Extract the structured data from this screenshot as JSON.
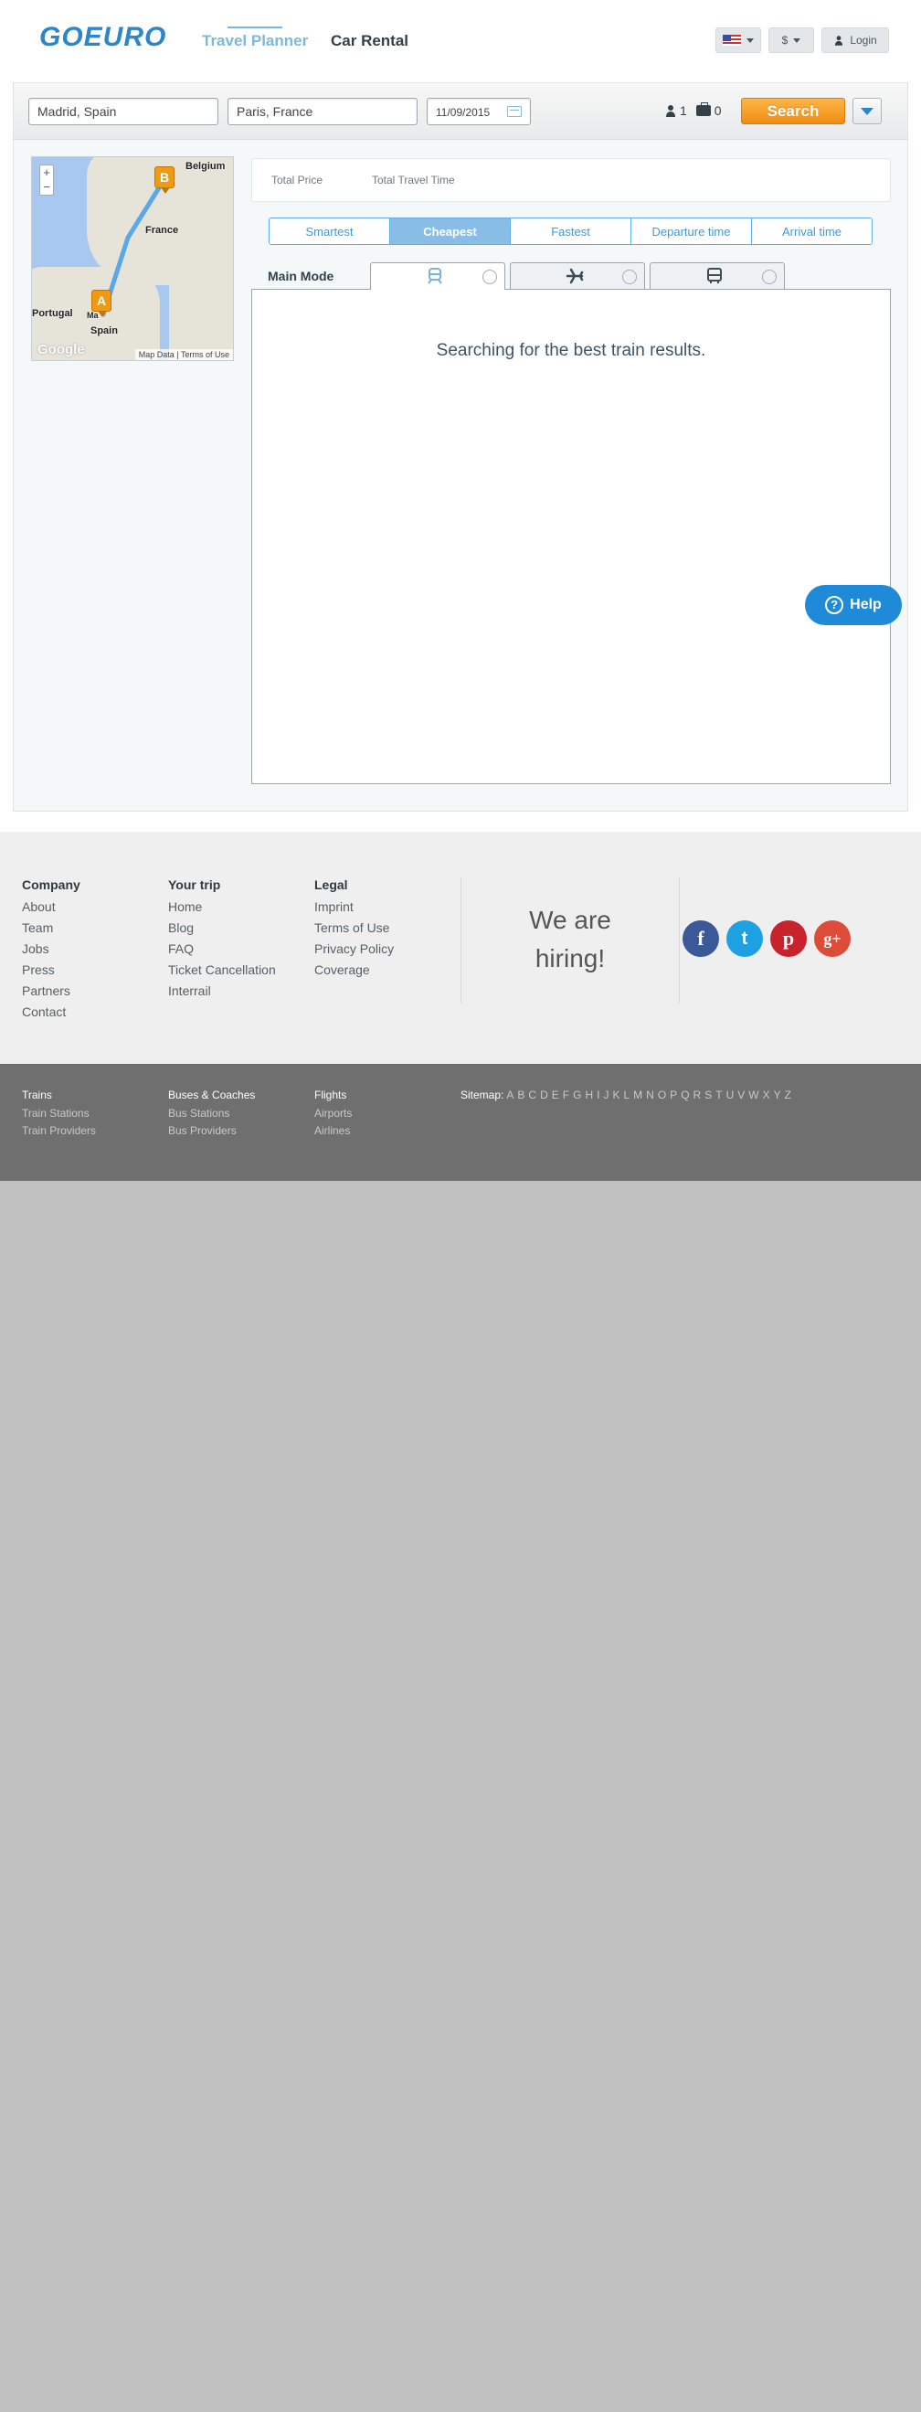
{
  "header": {
    "logo": "GOEURO",
    "nav": [
      "Travel Planner",
      "Car Rental"
    ],
    "currency": "$",
    "login": "Login"
  },
  "search": {
    "from": "Madrid, Spain",
    "to": "Paris, France",
    "date": "11/09/2015",
    "passengers": "1",
    "bags": "0",
    "button": "Search"
  },
  "map": {
    "labels": [
      "Belgium",
      "France",
      "Portugal",
      "Spain",
      "Ma"
    ],
    "markers": [
      "A",
      "B"
    ],
    "attribution": [
      "Map Data",
      "Terms of Use"
    ],
    "google": "Google",
    "zoom": [
      "+",
      "−"
    ]
  },
  "summary": {
    "total_price": "Total Price",
    "total_time": "Total Travel Time"
  },
  "sort_tabs": [
    "Smartest",
    "Cheapest",
    "Fastest",
    "Departure time",
    "Arrival time"
  ],
  "main_mode": "Main Mode",
  "modes": [
    "train-icon",
    "plane-icon",
    "bus-icon"
  ],
  "searching_text": "Searching for the best train results.",
  "help": "Help",
  "footer": {
    "company": {
      "title": "Company",
      "links": [
        "About",
        "Team",
        "Jobs",
        "Press",
        "Partners",
        "Contact"
      ]
    },
    "your_trip": {
      "title": "Your trip",
      "links": [
        "Home",
        "Blog",
        "FAQ",
        "Ticket Cancellation",
        "Interrail"
      ]
    },
    "legal": {
      "title": "Legal",
      "links": [
        "Imprint",
        "Terms of Use",
        "Privacy Policy",
        "Coverage"
      ]
    },
    "hiring": [
      "We are",
      "hiring!"
    ],
    "social": [
      "f",
      "t",
      "p",
      "g+"
    ]
  },
  "bottom": {
    "trains": {
      "title": "Trains",
      "links": [
        "Train Stations",
        "Train Providers"
      ]
    },
    "buses": {
      "title": "Buses & Coaches",
      "links": [
        "Bus Stations",
        "Bus Providers"
      ]
    },
    "flights": {
      "title": "Flights",
      "links": [
        "Airports",
        "Airlines"
      ]
    },
    "sitemap_label": "Sitemap:",
    "sitemap_letters": [
      "A",
      "B",
      "C",
      "D",
      "E",
      "F",
      "G",
      "H",
      "I",
      "J",
      "K",
      "L",
      "M",
      "N",
      "O",
      "P",
      "Q",
      "R",
      "S",
      "T",
      "U",
      "V",
      "W",
      "X",
      "Y",
      "Z"
    ]
  },
  "colors": {
    "brand": "#2c86c8",
    "search_button": "#f5a020",
    "help_button": "#1f8ad8",
    "active_sort": "#8abde6"
  }
}
